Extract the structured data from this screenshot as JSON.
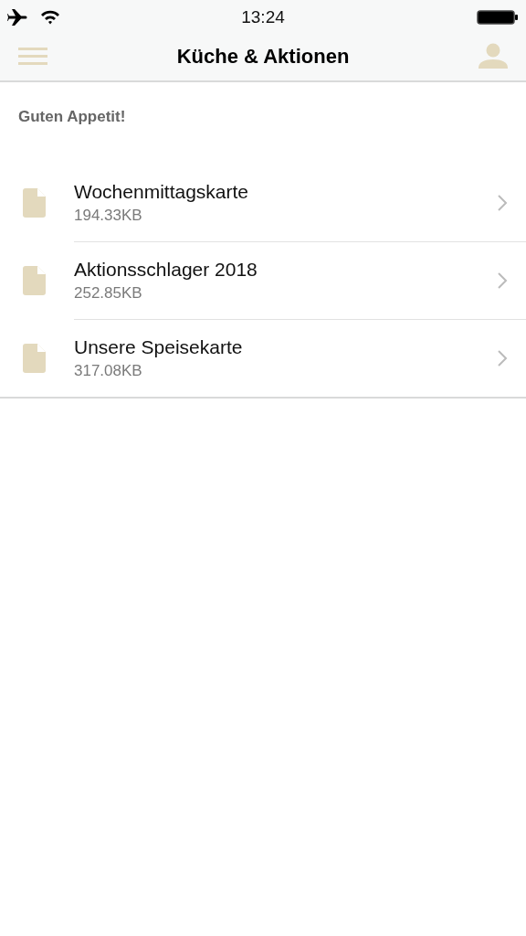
{
  "status_bar": {
    "time": "13:24"
  },
  "nav_bar": {
    "title": "Küche & Aktionen"
  },
  "heading": "Guten Appetit!",
  "files": [
    {
      "name": "Wochenmittagskarte",
      "size": "194.33KB"
    },
    {
      "name": "Aktionsschlager 2018",
      "size": "252.85KB"
    },
    {
      "name": "Unsere Speisekarte",
      "size": "317.08KB"
    }
  ]
}
